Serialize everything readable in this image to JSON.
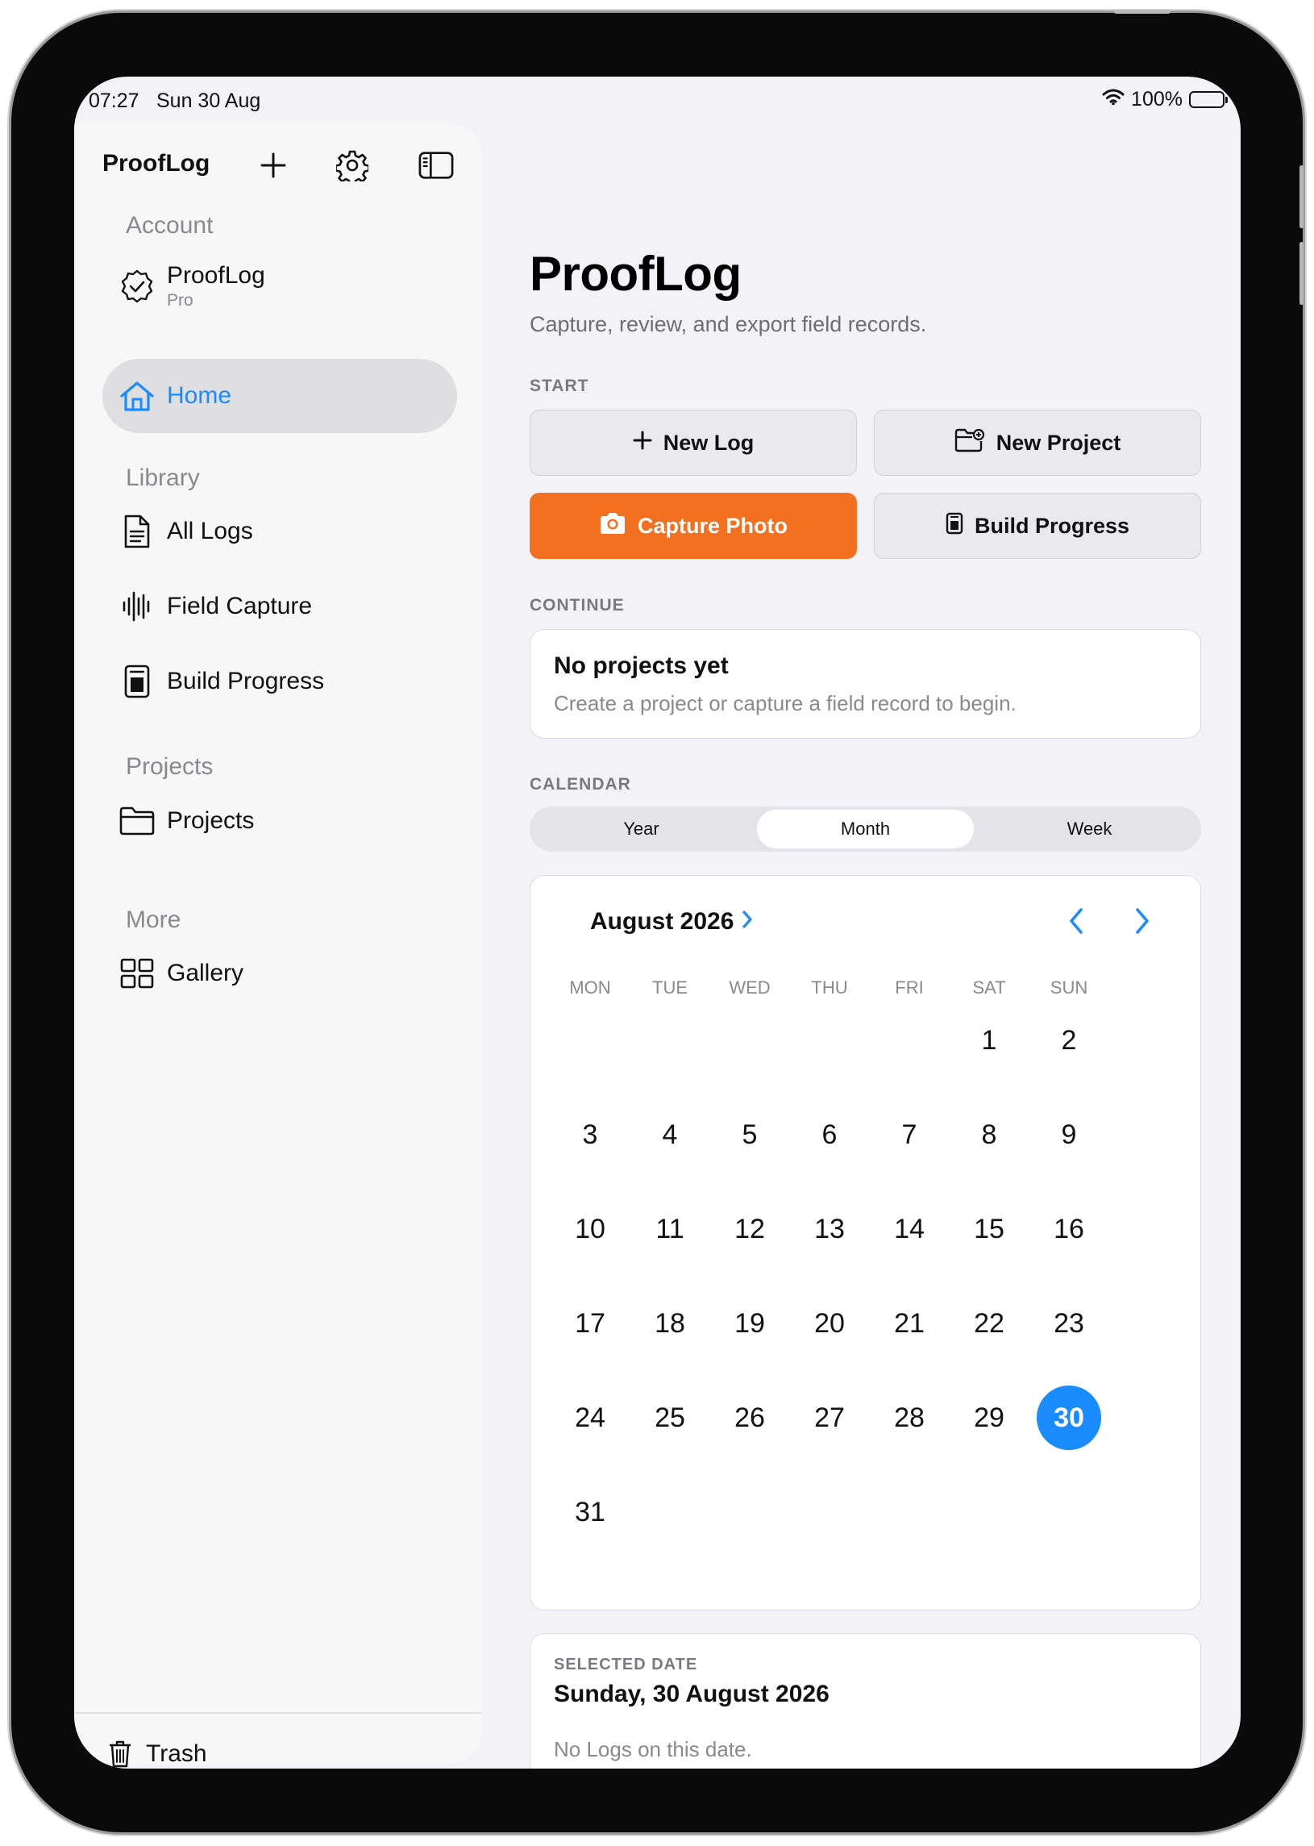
{
  "status": {
    "time": "07:27",
    "date": "Sun 30 Aug",
    "battery": "100%",
    "battery_level": 1.0
  },
  "sidebar": {
    "title": "ProofLog",
    "sections": {
      "account": "Account",
      "library": "Library",
      "projects": "Projects",
      "more": "More"
    },
    "account": {
      "name": "ProofLog",
      "plan": "Pro"
    },
    "items": {
      "home": "Home",
      "all_logs": "All Logs",
      "field_capture": "Field Capture",
      "build_progress": "Build Progress",
      "projects": "Projects",
      "gallery": "Gallery",
      "trash": "Trash"
    },
    "icons": [
      "plus-icon",
      "gear-icon",
      "sidebar-toggle-icon",
      "verified-badge-icon",
      "house-icon",
      "document-icon",
      "waveform-icon",
      "progress-icon",
      "folder-icon",
      "grid-icon",
      "trash-icon"
    ]
  },
  "main": {
    "title": "ProofLog",
    "subtitle": "Capture, review, and export field records.",
    "start_heading": "START",
    "buttons": {
      "new_log": "New Log",
      "new_project": "New Project",
      "capture_photo": "Capture Photo",
      "build_progress": "Build Progress"
    },
    "continue_heading": "CONTINUE",
    "empty": {
      "title": "No projects yet",
      "body": "Create a project or capture a field record to begin."
    },
    "calendar_heading": "CALENDAR",
    "segments": {
      "year": "Year",
      "month": "Month",
      "week": "Week",
      "selected": "Month"
    },
    "calendar": {
      "month_label": "August 2026",
      "weekdays": [
        "MON",
        "TUE",
        "WED",
        "THU",
        "FRI",
        "SAT",
        "SUN"
      ],
      "first_weekday_index": 5,
      "days_in_month": 31,
      "selected_day": 30
    },
    "selected": {
      "heading": "SELECTED DATE",
      "date": "Sunday, 30 August 2026",
      "empty": "No Logs on this date."
    }
  },
  "colors": {
    "accent": "#1a8cff",
    "primary_button": "#f37021",
    "background": "#f2f2f7"
  }
}
